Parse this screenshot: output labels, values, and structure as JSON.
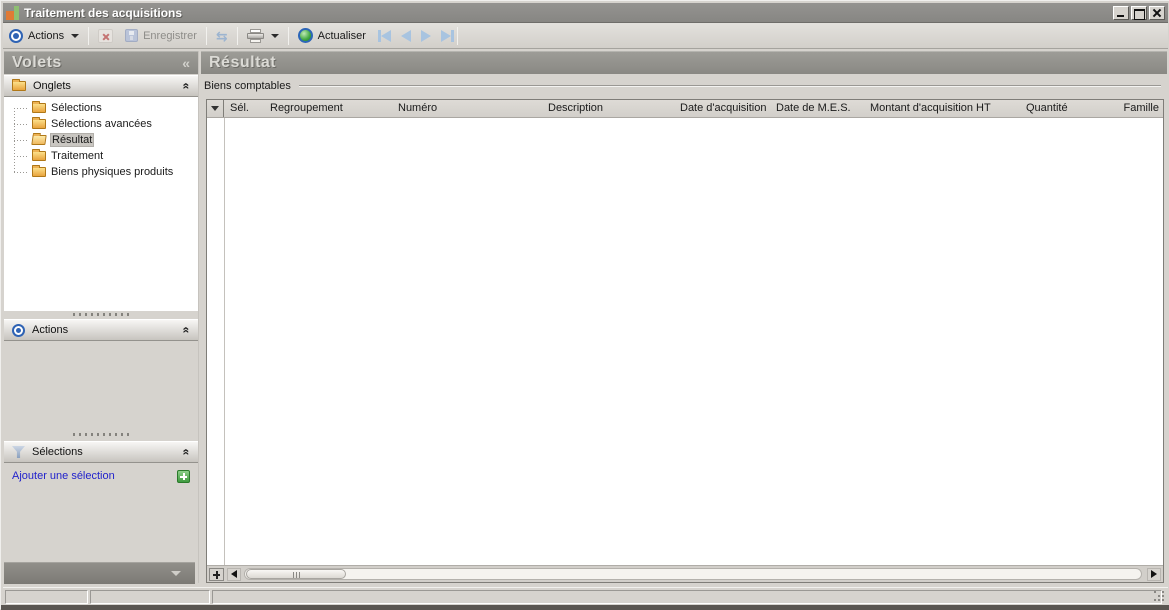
{
  "window": {
    "title": "Traitement des acquisitions"
  },
  "toolbar": {
    "actions_label": "Actions",
    "save_label": "Enregistrer",
    "refresh_label": "Actualiser"
  },
  "sidebar": {
    "title": "Volets",
    "collapse_glyph": "«",
    "onglets": {
      "label": "Onglets",
      "items": [
        {
          "label": "Sélections",
          "selected": false
        },
        {
          "label": "Sélections avancées",
          "selected": false
        },
        {
          "label": "Résultat",
          "selected": true
        },
        {
          "label": "Traitement",
          "selected": false
        },
        {
          "label": "Biens physiques produits",
          "selected": false
        }
      ]
    },
    "actions_section": {
      "label": "Actions"
    },
    "selections_section": {
      "label": "Sélections",
      "add_link": "Ajouter une sélection"
    }
  },
  "main": {
    "title": "Résultat",
    "group_label": "Biens comptables",
    "table": {
      "columns": [
        "Sél.",
        "Regroupement",
        "Numéro",
        "Description",
        "Date d'acquisition",
        "Date de M.E.S.",
        "Montant d'acquisition HT",
        "Quantité",
        "Famille"
      ],
      "rows": []
    }
  },
  "icons": {
    "app-icon": "orange-green-blocks",
    "actions-icon": "blue-bullseye",
    "delete-icon": "red-x",
    "save-icon": "blue-diskette",
    "sync-icon": "blue-double-arrows",
    "print-icon": "printer",
    "refresh-icon": "green-ball-blue-ring",
    "folder-icon": "yellow-folder",
    "filter-icon": "funnel",
    "add-icon": "green-plus"
  },
  "colors": {
    "window_bg": "#d6d3ce",
    "titlebar_bg": "#8b8a86",
    "accent_blue": "#2f63b4",
    "link_blue": "#2222cc",
    "folder_yellow": "#e9a43e",
    "refresh_green": "#44aa44",
    "selection_gray": "#c9c6c1"
  }
}
